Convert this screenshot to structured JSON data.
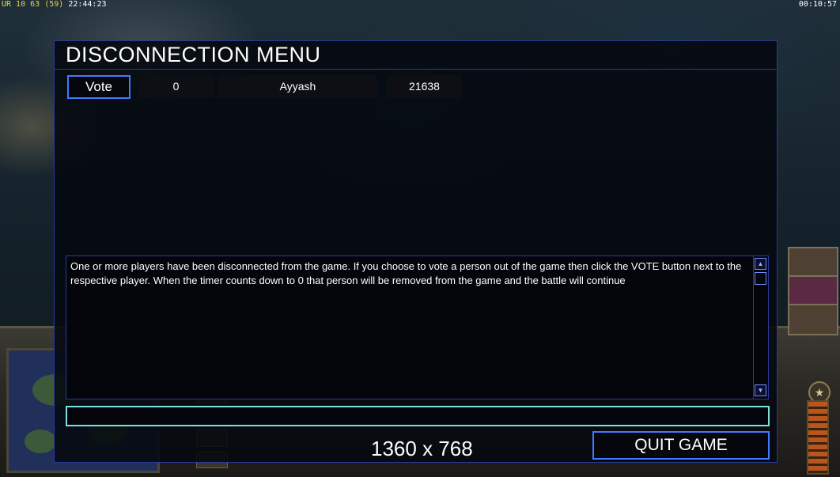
{
  "hud": {
    "top_left_prefix": "UR 10 63",
    "top_left_bracket": "(59)",
    "top_left_time": "22:44:23",
    "top_right_time": "00:10:57"
  },
  "dialog": {
    "title": "DISCONNECTION MENU",
    "player_row": {
      "vote_label": "Vote",
      "votes": "0",
      "name": "Ayyash",
      "ping": "21638"
    },
    "message": "One or more players have been disconnected from the game. If you choose to vote a person out of the game then click the VOTE button next to the respective player. When the timer counts down to 0 that person will be removed from the game and the battle will continue",
    "chat_value": "",
    "resolution": "1360 x 768",
    "quit_label": "QUIT GAME"
  },
  "icons": {
    "scroll_up": "scroll-up-arrow-icon",
    "scroll_down": "scroll-down-arrow-icon",
    "rank": "rank-star-icon"
  },
  "colors": {
    "accent_border": "#3e7bff",
    "frame": "#2a3a96",
    "chat_border": "#7fe0e0"
  }
}
